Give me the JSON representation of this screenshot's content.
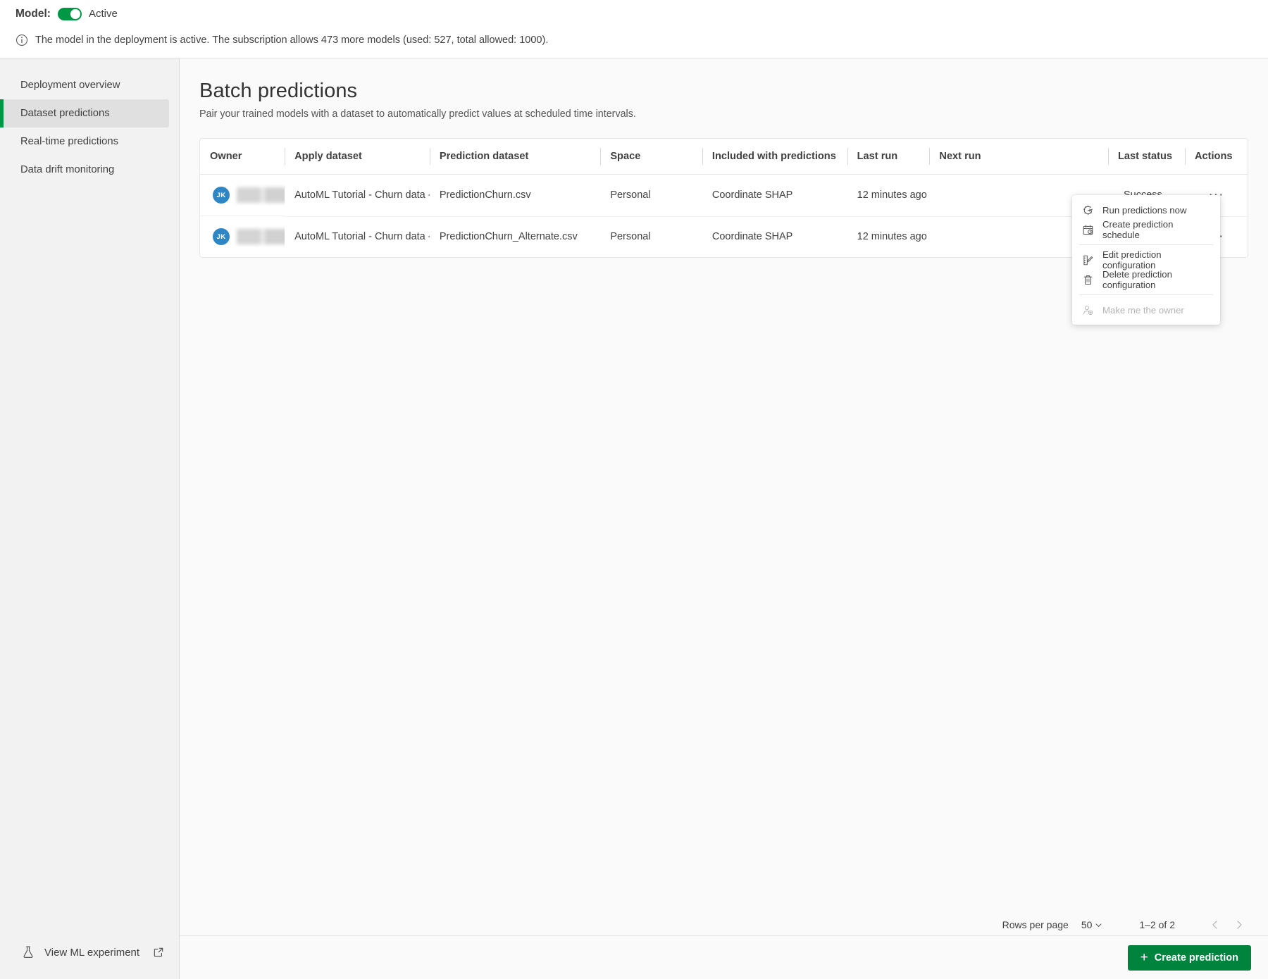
{
  "topbar": {
    "model_label": "Model:",
    "toggle_state_label": "Active",
    "toggle_on": true,
    "info_text": "The model in the deployment is active. The subscription allows 473 more models (used: 527, total allowed: 1000).",
    "accent_green": "#009845"
  },
  "sidebar": {
    "items": [
      {
        "label": "Deployment overview",
        "active": false
      },
      {
        "label": "Dataset predictions",
        "active": true
      },
      {
        "label": "Real-time predictions",
        "active": false
      },
      {
        "label": "Data drift monitoring",
        "active": false
      }
    ],
    "footer": {
      "label": "View ML experiment"
    }
  },
  "page": {
    "title": "Batch predictions",
    "subtitle": "Pair your trained models with a dataset to automatically predict values at scheduled time intervals."
  },
  "table": {
    "columns": [
      "Owner",
      "Apply dataset",
      "Prediction dataset",
      "Space",
      "Included with predictions",
      "Last run",
      "Next run",
      "Last status",
      "Actions"
    ],
    "rows": [
      {
        "owner_initials": "JK",
        "owner_name": "",
        "apply_dataset": "AutoML Tutorial - Churn data - ap",
        "prediction_dataset": "PredictionChurn.csv",
        "space": "Personal",
        "included_with_predictions": "Coordinate SHAP",
        "last_run": "12 minutes ago",
        "next_run": "",
        "last_status": "Success",
        "actions": "···"
      },
      {
        "owner_initials": "JK",
        "owner_name": "",
        "apply_dataset": "AutoML Tutorial - Churn data - ap",
        "prediction_dataset": "PredictionChurn_Alternate.csv",
        "space": "Personal",
        "included_with_predictions": "Coordinate SHAP",
        "last_run": "12 minutes ago",
        "next_run": "",
        "last_status": "",
        "actions": "···"
      }
    ]
  },
  "context_menu": {
    "items": [
      {
        "label": "Run predictions now",
        "icon": "run-gear-icon",
        "disabled": false
      },
      {
        "label": "Create prediction schedule",
        "icon": "calendar-clock-icon",
        "disabled": false
      },
      {
        "separator": true
      },
      {
        "label": "Edit prediction configuration",
        "icon": "edit-pencil-icon",
        "disabled": false
      },
      {
        "label": "Delete prediction configuration",
        "icon": "trash-icon",
        "disabled": false
      },
      {
        "separator": true
      },
      {
        "label": "Make me the owner",
        "icon": "user-add-icon",
        "disabled": true
      }
    ]
  },
  "pagination": {
    "rows_per_page_label": "Rows per page",
    "rows_per_page_value": "50",
    "range_label": "1–2 of 2"
  },
  "bottombar": {
    "create_label": "Create prediction",
    "create_color": "#00843D"
  }
}
